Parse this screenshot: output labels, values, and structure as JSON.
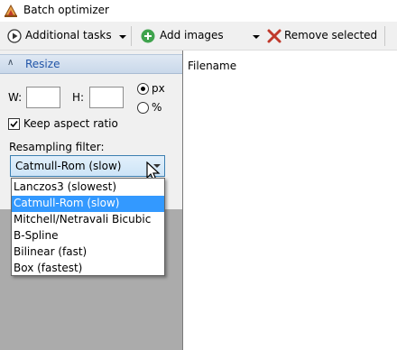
{
  "window": {
    "title": "Batch optimizer",
    "icon": "app-logo-icon"
  },
  "toolbar": {
    "additional_tasks_label": "Additional tasks",
    "add_images_label": "Add images",
    "remove_selected_label": "Remove selected"
  },
  "resize": {
    "section_label": "Resize",
    "width_label": "W:",
    "width_value": "",
    "height_label": "H:",
    "height_value": "",
    "unit_px_label": "px",
    "unit_percent_label": "%",
    "selected_unit": "px",
    "keep_aspect_label": "Keep aspect ratio",
    "keep_aspect_checked": true,
    "resampling_label": "Resampling filter:",
    "resampling_selected": "Catmull-Rom (slow)",
    "resampling_options": [
      "Lanczos3 (slowest)",
      "Catmull-Rom (slow)",
      "Mitchell/Netravali Bicubic",
      "B-Spline",
      "Bilinear (fast)",
      "Box (fastest)"
    ],
    "highlighted_option": 1
  },
  "file_list": {
    "column_filename": "Filename"
  },
  "colors": {
    "accent": "#3399ff",
    "section_header_text": "#2155a8",
    "remove_icon": "#c0392b",
    "add_icon": "#3fa34d"
  }
}
